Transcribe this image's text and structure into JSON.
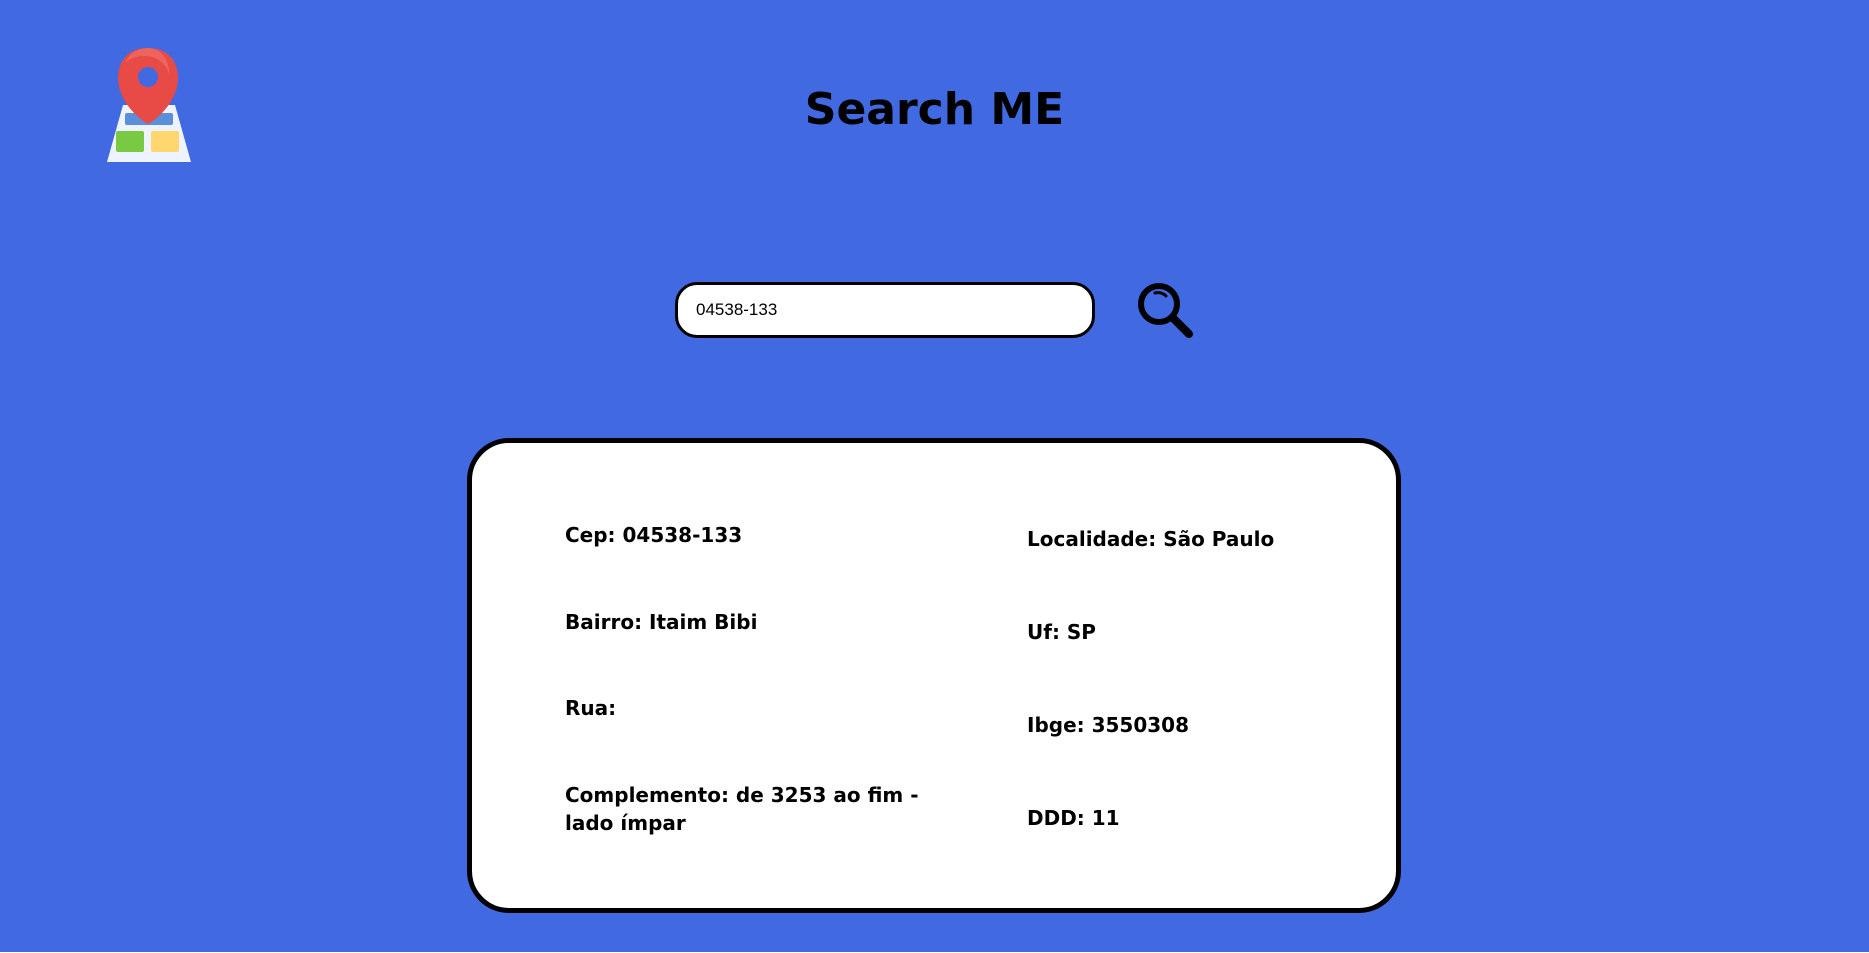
{
  "app": {
    "title": "Search ME",
    "logo_icon": "map-pin-icon",
    "colors": {
      "background": "#4169e1",
      "card": "#ffffff",
      "text": "#000000",
      "pin": "#e84a45",
      "map": "#eef4ff",
      "map_green": "#7ac943",
      "map_yellow": "#ffd76e",
      "map_blue": "#5b8fd9"
    }
  },
  "search": {
    "value": "04538-133",
    "button_icon": "search-icon"
  },
  "result": {
    "left": [
      "Cep: 04538-133",
      "Bairro: Itaim Bibi",
      "Rua:",
      "Complemento: de 3253 ao fim - lado ímpar"
    ],
    "right": [
      "Localidade: São Paulo",
      "Uf: SP",
      "Ibge: 3550308",
      "DDD: 11"
    ]
  }
}
